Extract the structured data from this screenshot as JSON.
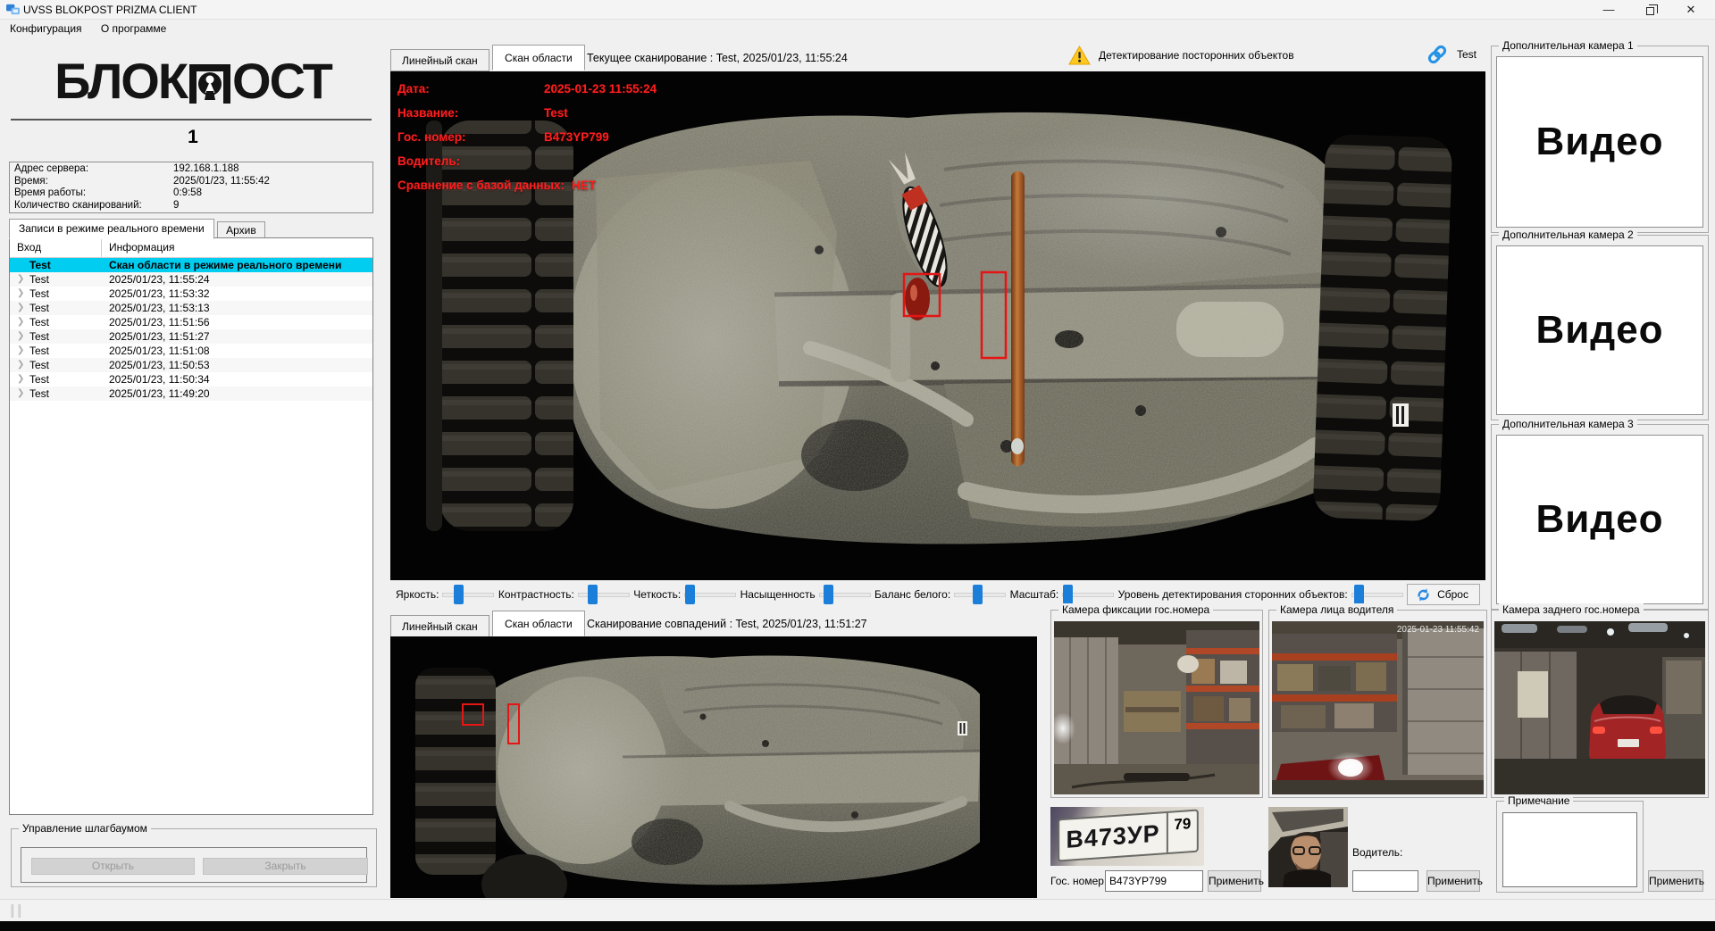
{
  "window": {
    "title": "UVSS BLOKPOST PRIZMA CLIENT",
    "menu": [
      "Конфигурация",
      "О программе"
    ]
  },
  "sidebar": {
    "logo_left": "БЛОК",
    "logo_right": "ОСТ",
    "counter": "1",
    "info": [
      {
        "label": "Адрес сервера:",
        "value": "192.168.1.188"
      },
      {
        "label": "Время:",
        "value": "2025/01/23, 11:55:42"
      },
      {
        "label": "Время работы:",
        "value": "0:9:58"
      },
      {
        "label": "Количество сканирований:",
        "value": "9"
      }
    ],
    "tabs": {
      "realtime": "Записи в режиме реального времени",
      "archive": "Архив"
    },
    "table": {
      "col_entry": "Вход",
      "col_info": "Информация",
      "selected": {
        "name": "Test",
        "info": "Скан области в режиме реального времени"
      },
      "rows": [
        {
          "name": "Test",
          "info": "2025/01/23, 11:55:24"
        },
        {
          "name": "Test",
          "info": "2025/01/23, 11:53:32"
        },
        {
          "name": "Test",
          "info": "2025/01/23, 11:53:13"
        },
        {
          "name": "Test",
          "info": "2025/01/23, 11:51:56"
        },
        {
          "name": "Test",
          "info": "2025/01/23, 11:51:27"
        },
        {
          "name": "Test",
          "info": "2025/01/23, 11:51:08"
        },
        {
          "name": "Test",
          "info": "2025/01/23, 11:50:53"
        },
        {
          "name": "Test",
          "info": "2025/01/23, 11:50:34"
        },
        {
          "name": "Test",
          "info": "2025/01/23, 11:49:20"
        }
      ]
    },
    "barrier": {
      "title": "Управление шлагбаумом",
      "open": "Открыть",
      "close": "Закрыть"
    }
  },
  "scan_top": {
    "tab_linear": "Линейный скан",
    "tab_area": "Скан области",
    "caption": "Текущее сканирование : Test, 2025/01/23, 11:55:24",
    "warning": "Детектирование посторонних объектов",
    "link": "Test",
    "overlay": {
      "rows": [
        {
          "label": "Дата:",
          "value": "2025-01-23 11:55:24"
        },
        {
          "label": "Название:",
          "value": "Test"
        },
        {
          "label": "Гос. номер:",
          "value": "B473YP799"
        },
        {
          "label": "Водитель:",
          "value": ""
        },
        {
          "label": "Сравнение с базой данных:",
          "value": "НЕТ"
        }
      ]
    }
  },
  "adjustments": {
    "sliders": [
      {
        "label": "Яркость:",
        "value": 30
      },
      {
        "label": "Контрастность:",
        "value": 28
      },
      {
        "label": "Четкость:",
        "value": 10
      },
      {
        "label": "Насыщенность",
        "value": 18
      },
      {
        "label": "Баланс белого:",
        "value": 45
      },
      {
        "label": "Масштаб:",
        "value": 10
      },
      {
        "label": "Уровень детектирования сторонних объектов:",
        "value": 15
      }
    ],
    "reset": "Сброс"
  },
  "scan_match": {
    "tab_linear": "Линейный скан",
    "tab_area": "Скан области",
    "caption": "Сканирование совпадений : Test, 2025/01/23, 11:51:27"
  },
  "extra_cameras": {
    "titles": [
      "Дополнительная камера 1",
      "Дополнительная камера 2",
      "Дополнительная камера 3"
    ],
    "placeholder": "Видео"
  },
  "cameras": {
    "plate": "Камера фиксации гос.номера",
    "face": "Камера лица водителя",
    "rear": "Камера заднего гос.номера",
    "face_timestamp": "2025-01-23 11:55:42"
  },
  "plate_form": {
    "plate_main": "В473УР",
    "plate_region": "79",
    "label": "Гос. номер:",
    "value": "B473YP799",
    "apply": "Применить"
  },
  "driver_form": {
    "label": "Водитель:",
    "value": "",
    "apply": "Применить"
  },
  "note_form": {
    "title": "Примечание",
    "value": "",
    "apply": "Применить"
  }
}
